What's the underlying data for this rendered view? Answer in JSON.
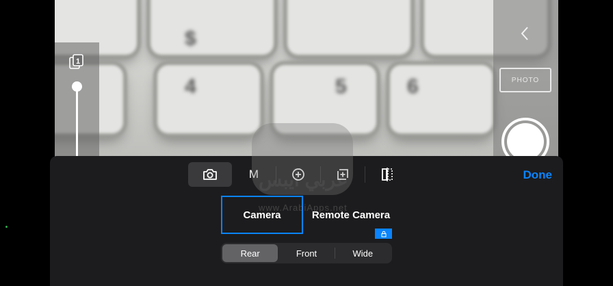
{
  "left_controls": {
    "ratio_icon": "aspect-ratio-icon",
    "zoom_level": 0.0
  },
  "right_controls": {
    "back_icon": "chevron-left-icon",
    "photo_label": "PHOTO",
    "shutter_icon": "shutter-icon"
  },
  "watermark": {
    "text_ar": "عربي آيبس",
    "url": "www.ArabiApps.net"
  },
  "toolbar": {
    "items": [
      {
        "icon": "camera-icon",
        "selected": true
      },
      {
        "label": "M"
      },
      {
        "icon": "zoom-plus-icon"
      },
      {
        "icon": "exposure-plus-icon"
      },
      {
        "icon": "mirror-icon"
      }
    ],
    "done_label": "Done"
  },
  "camera_source": {
    "camera_label": "Camera",
    "remote_label": "Remote Camera",
    "selected": "Camera"
  },
  "lens": {
    "options": [
      "Rear",
      "Front",
      "Wide"
    ],
    "selected": "Rear"
  },
  "colors": {
    "accent": "#0a84ff",
    "sheet_bg": "#1c1c1e",
    "selected_tool": "#3a3a3c"
  }
}
